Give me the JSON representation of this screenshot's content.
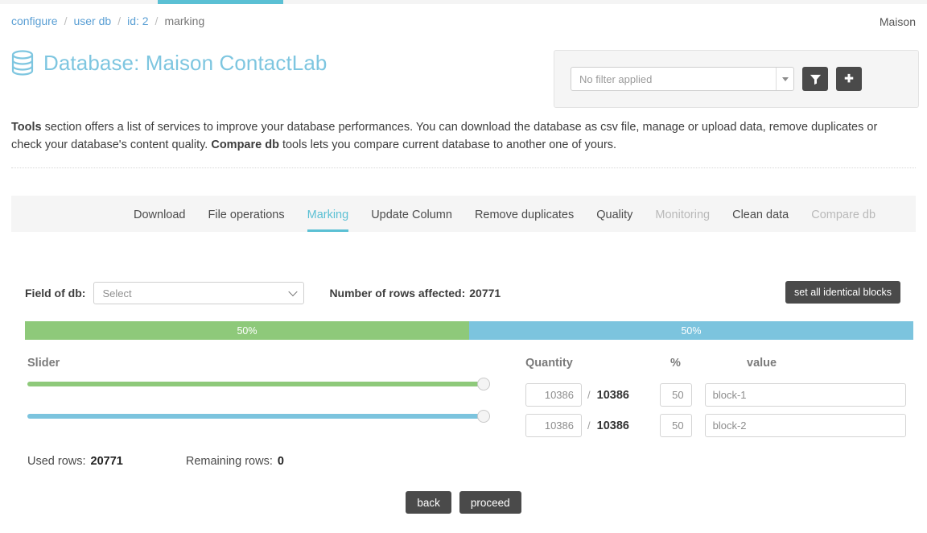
{
  "topbar": {
    "progress_percent": 14
  },
  "breadcrumb": {
    "items": [
      {
        "label": "configure",
        "type": "link"
      },
      {
        "label": "user db",
        "type": "link"
      },
      {
        "label": "id: 2",
        "type": "link"
      },
      {
        "label": "marking",
        "type": "current"
      }
    ],
    "separator": "/"
  },
  "header": {
    "user": "Maison",
    "title": "Database: Maison ContactLab",
    "db_icon": "database-icon",
    "accent_color": "#7ec6e0"
  },
  "filter_panel": {
    "select_value": "No filter applied",
    "caret_icon": "chevron-down-icon",
    "filter_button_icon": "funnel-icon",
    "add_button_icon": "plus-icon"
  },
  "description": {
    "part1_bold": "Tools",
    "part2": " section offers a list of services to improve your database performances. You can download the database as csv file, manage or upload data, remove duplicates or check your database's content quality. ",
    "part3_bold": "Compare db",
    "part4": " tools lets you compare current database to another one of yours."
  },
  "tabs": [
    {
      "label": "Download",
      "state": "normal"
    },
    {
      "label": "File operations",
      "state": "normal"
    },
    {
      "label": "Marking",
      "state": "active"
    },
    {
      "label": "Update Column",
      "state": "normal"
    },
    {
      "label": "Remove duplicates",
      "state": "normal"
    },
    {
      "label": "Quality",
      "state": "normal"
    },
    {
      "label": "Monitoring",
      "state": "disabled"
    },
    {
      "label": "Clean data",
      "state": "normal"
    },
    {
      "label": "Compare db",
      "state": "disabled"
    }
  ],
  "form": {
    "field_label": "Field of db:",
    "field_select_value": "Select",
    "rows_affected_label": "Number of rows affected:",
    "rows_affected_value": "20771",
    "set_blocks_label": "set all identical blocks"
  },
  "ratio_bar": {
    "segments": [
      {
        "label": "50%",
        "percent": 50,
        "color": "#8ec97a"
      },
      {
        "label": "50%",
        "percent": 50,
        "color": "#7cc4de"
      }
    ]
  },
  "slider_section": {
    "heading": "Slider",
    "sliders": [
      {
        "name": "slider-block-1",
        "value_percent": 100,
        "color": "#8ec97a"
      },
      {
        "name": "slider-block-2",
        "value_percent": 100,
        "color": "#7cc4de"
      }
    ]
  },
  "quantity_table": {
    "headers": {
      "quantity": "Quantity",
      "percent": "%",
      "value": "value"
    },
    "separator": "/",
    "rows": [
      {
        "quantity": "10386",
        "total": "10386",
        "percent": "50",
        "value": "block-1"
      },
      {
        "quantity": "10386",
        "total": "10386",
        "percent": "50",
        "value": "block-2"
      }
    ]
  },
  "footer": {
    "used_rows_label": "Used rows:",
    "used_rows_value": "20771",
    "remaining_rows_label": "Remaining rows:",
    "remaining_rows_value": "0",
    "back_label": "back",
    "proceed_label": "proceed"
  }
}
